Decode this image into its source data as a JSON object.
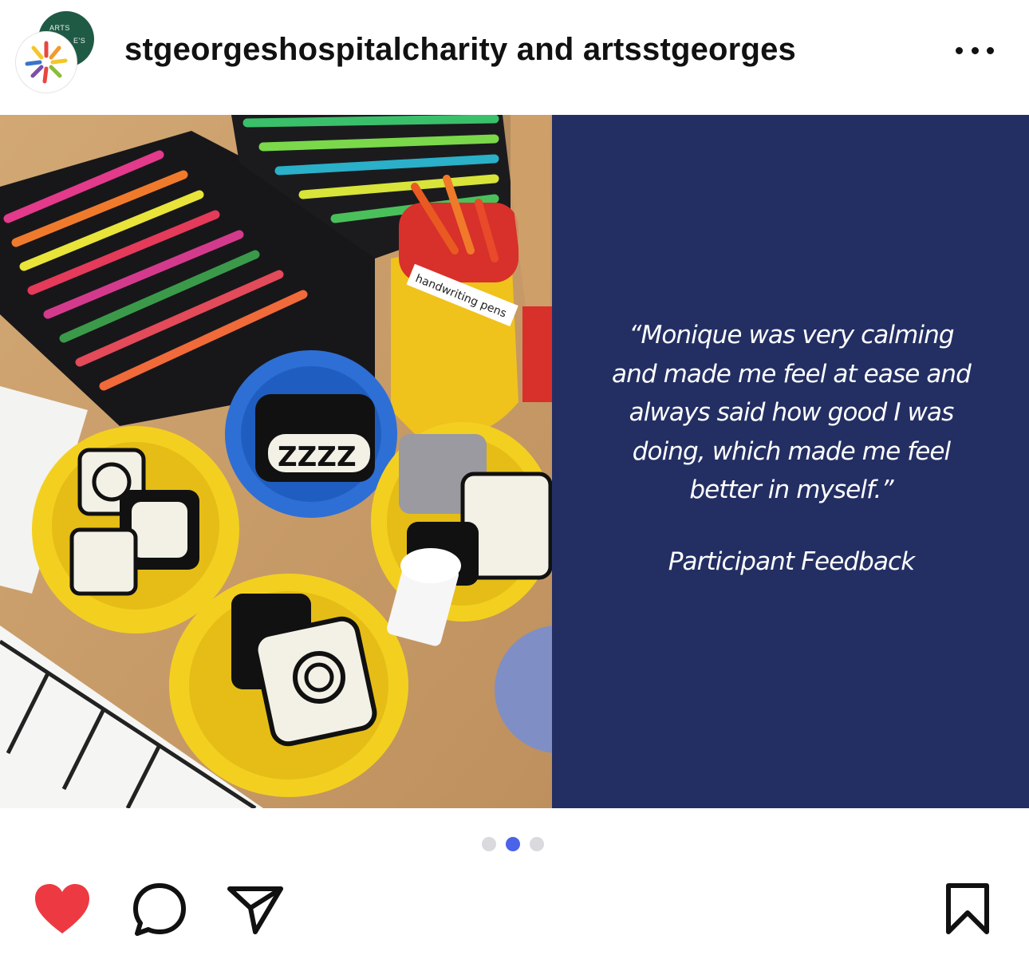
{
  "header": {
    "account_line": "stgeorgeshospitalcharity and artsstgeorges",
    "more_icon": "ellipsis-icon",
    "avatar_back_text_1": "ARTS",
    "avatar_back_text_2": "E'S"
  },
  "post": {
    "image_left": "photo of art supplies: marker pens, handwriting pens pot, bowls of black and white picture tiles",
    "pen_pot_label": "handwriting pens",
    "tile_text": "ZZZZ",
    "quote": "“Monique was very calming and made me feel at ease and always said how good I was doing, which made me feel better in myself.”",
    "attribution": "Participant Feedback",
    "panel_color": "#232f63"
  },
  "carousel": {
    "total": 3,
    "active_index": 1,
    "active_color": "#4b63e8",
    "inactive_color": "#d9d9de"
  },
  "actions": {
    "like_icon": "heart-icon",
    "liked": true,
    "like_color": "#ed3a42",
    "comment_icon": "comment-icon",
    "share_icon": "paper-plane-icon",
    "save_icon": "bookmark-icon"
  }
}
